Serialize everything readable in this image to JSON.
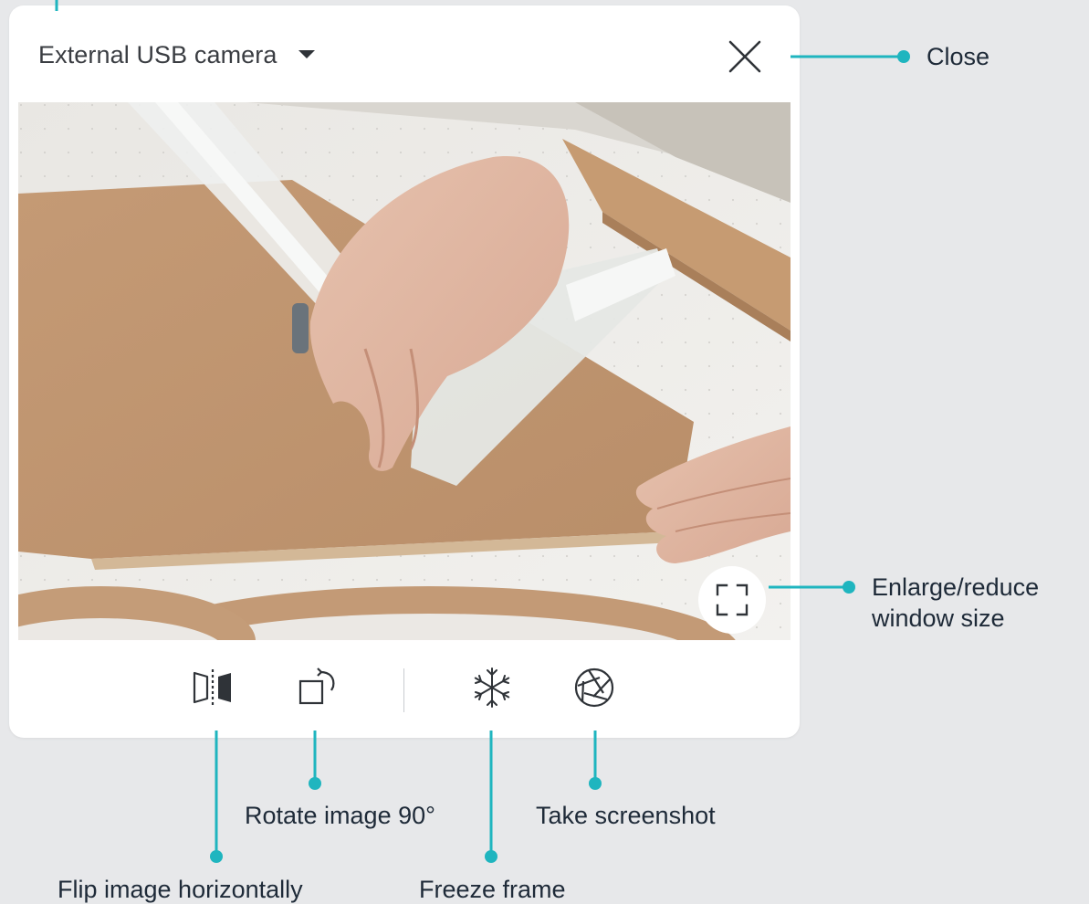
{
  "panel": {
    "source_select": {
      "label": "External USB camera",
      "icon": "caret-down-icon"
    },
    "close_icon": "close-icon",
    "fullscreen_icon": "fullscreen-icon",
    "toolbar": {
      "flip_icon": "flip-horizontal-icon",
      "rotate_icon": "rotate-icon",
      "freeze_icon": "snowflake-icon",
      "screenshot_icon": "camera-shutter-icon"
    }
  },
  "callouts": {
    "close": "Close",
    "enlarge_line1": "Enlarge/reduce",
    "enlarge_line2": "window size",
    "rotate": "Rotate image 90°",
    "screenshot": "Take screenshot",
    "flip": "Flip image horizontally",
    "freeze": "Freeze frame"
  },
  "colors": {
    "accent": "#1fb5bf",
    "callout_text": "#1e2a38",
    "background": "#e7e8ea",
    "panel": "#ffffff",
    "icon": "#2f3338"
  }
}
